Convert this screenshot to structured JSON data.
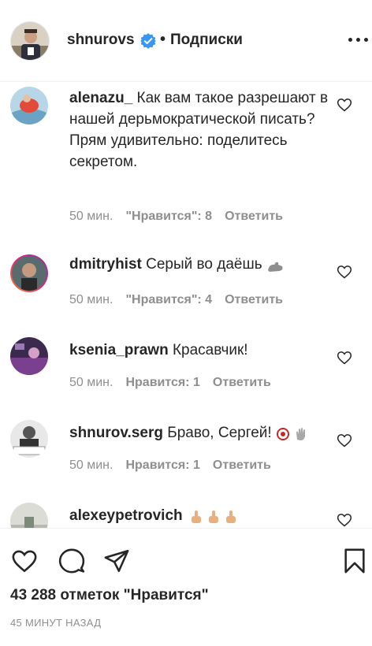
{
  "header": {
    "username": "shnurovs",
    "separator": "•",
    "follow_label": "Подписки",
    "verified_icon": "verified-badge-icon",
    "more_icon": "more-options-icon"
  },
  "comments": [
    {
      "username": "alenazu_",
      "text": "Как вам такое разрешают в нашей дерьмократической писать? Прям удивительно: поделитесь секретом.",
      "time": "50 мин.",
      "likes": "\"Нравится\": 8",
      "reply": "Ответить"
    },
    {
      "username": "dmitryhist",
      "text": "Серый во даёшь",
      "emoji": "muscle-emoji",
      "time": "50 мин.",
      "likes": "\"Нравится\": 4",
      "reply": "Ответить"
    },
    {
      "username": "ksenia_prawn",
      "text": "Красавчик!",
      "time": "50 мин.",
      "likes": "Нравится: 1",
      "reply": "Ответить"
    },
    {
      "username": "shnurov.serg",
      "text": "Браво, Сергей!",
      "emoji": "target-and-waving-hand-emoji",
      "time": "50 мин.",
      "likes": "Нравится: 1",
      "reply": "Ответить"
    },
    {
      "username": "alexeypetrovich",
      "text": "",
      "emoji": "three-middle-finger-emoji"
    }
  ],
  "actions": {
    "likes_total": "43 288 отметок \"Нравится\"",
    "time_ago": "45 МИНУТ НАЗАД"
  },
  "colors": {
    "text": "#262626",
    "secondary": "#8e8e8e",
    "verified": "#3897f0",
    "divider": "#efefef"
  }
}
